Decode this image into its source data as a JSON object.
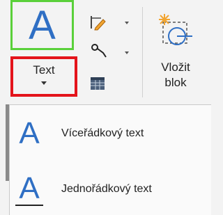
{
  "ribbon": {
    "text_button_label": "Text",
    "big_icon_glyph": "A",
    "insert_block_label_line1": "Vložit",
    "insert_block_label_line2": "blok"
  },
  "dropdown": {
    "items": [
      {
        "label": "Víceřádkový text",
        "icon": "A"
      },
      {
        "label": "Jednořádkový text",
        "icon": "A"
      }
    ]
  },
  "colors": {
    "accent_blue": "#2f6fc4",
    "highlight_green": "#5ad03a",
    "highlight_red": "#e4141b"
  }
}
